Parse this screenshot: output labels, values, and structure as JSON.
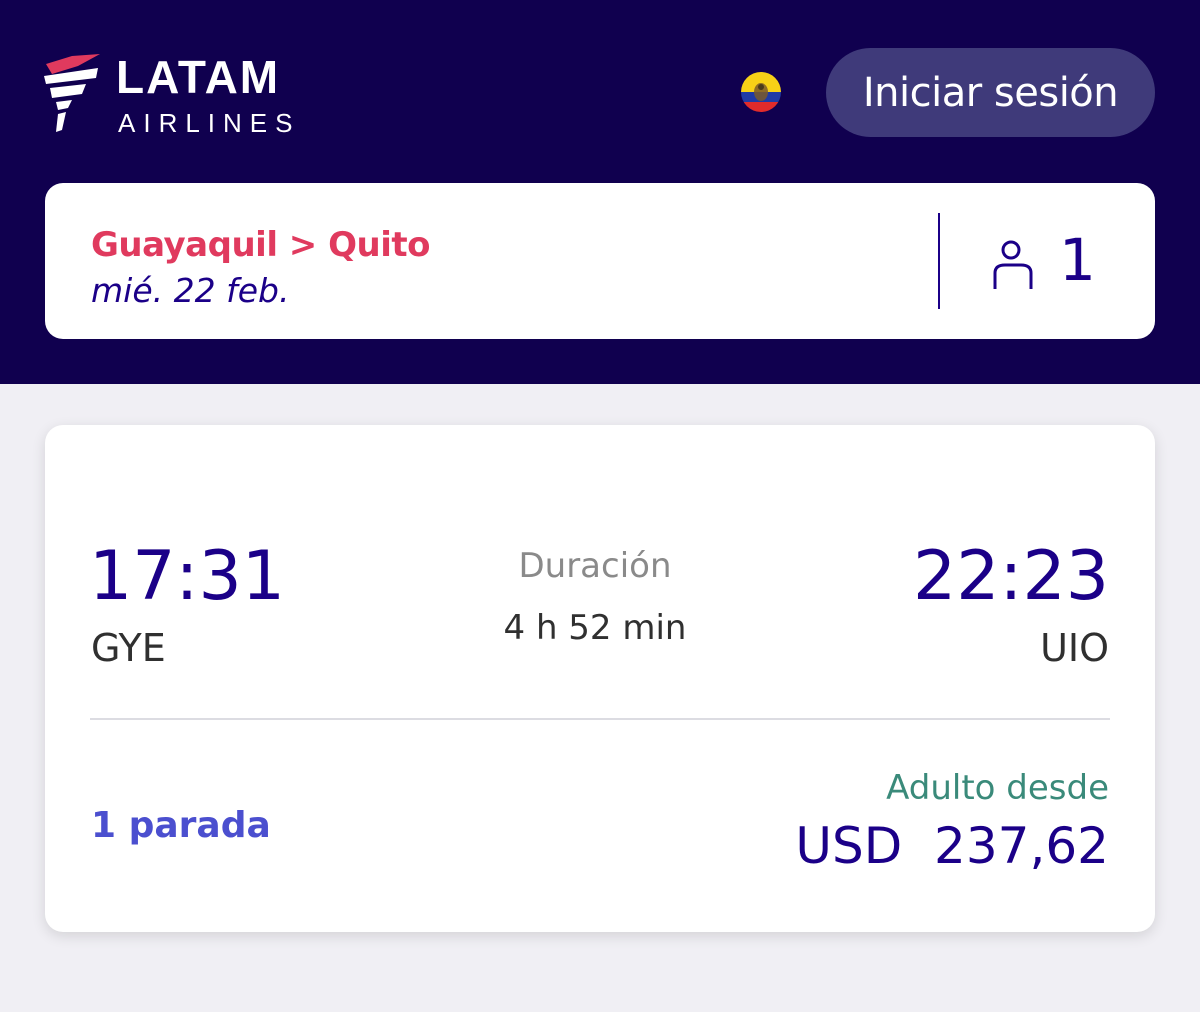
{
  "header": {
    "logo": {
      "brand": "LATAM",
      "subtitle": "AIRLINES"
    },
    "country_flag_icon": "ecuador-flag-icon",
    "login_label": "Iniciar sesión"
  },
  "search": {
    "route": "Guayaquil > Quito",
    "date": "mié. 22 feb.",
    "passenger_icon": "person-icon",
    "passenger_count": "1"
  },
  "flight": {
    "departure_time": "17:31",
    "departure_code": "GYE",
    "duration_label": "Duración",
    "duration_value": "4 h 52 min",
    "arrival_time": "22:23",
    "arrival_code": "UIO",
    "stops": "1 parada",
    "price_label": "Adulto desde",
    "price": "USD  237,62"
  },
  "colors": {
    "header_bg": "#10004f",
    "accent_red": "#e03a5e",
    "accent_blue": "#1b0088",
    "stops_blue": "#4b4fcf",
    "price_label_green": "#3a8a7a",
    "login_bg": "#3f3a7a",
    "page_bg": "#f0eff4"
  }
}
